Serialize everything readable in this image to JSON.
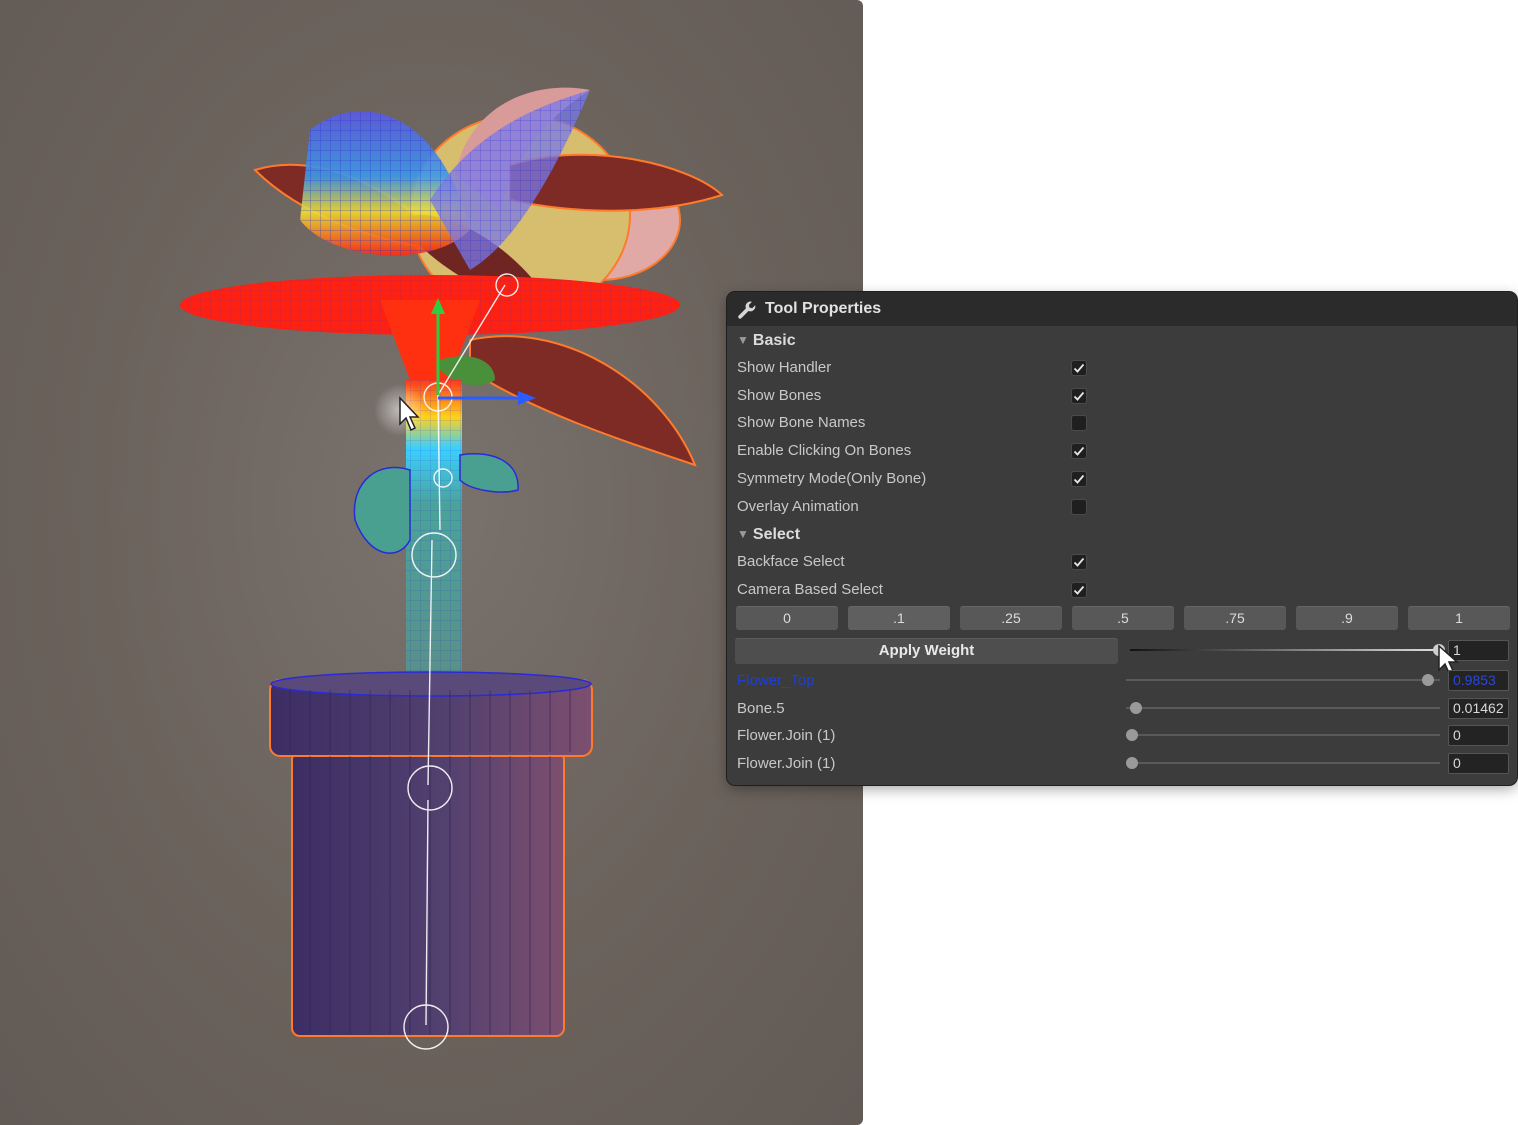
{
  "panel": {
    "title": "Tool Properties",
    "sections": {
      "basic": "Basic",
      "select": "Select"
    },
    "basic_options": [
      {
        "label": "Show Handler",
        "checked": true
      },
      {
        "label": "Show Bones",
        "checked": true
      },
      {
        "label": "Show Bone Names",
        "checked": false
      },
      {
        "label": "Enable Clicking On Bones",
        "checked": true
      },
      {
        "label": "Symmetry Mode(Only Bone)",
        "checked": true
      },
      {
        "label": "Overlay Animation",
        "checked": false
      }
    ],
    "select_options": [
      {
        "label": "Backface Select",
        "checked": true
      },
      {
        "label": "Camera Based Select",
        "checked": true
      }
    ],
    "weight_presets": [
      "0",
      ".1",
      ".25",
      ".5",
      ".75",
      ".9",
      "1"
    ],
    "apply_weight": {
      "label": "Apply Weight",
      "value": "1",
      "slider": 1.0
    },
    "bones": [
      {
        "name": "Flower_Top",
        "value": "0.9853",
        "slider": 0.985,
        "selected": true
      },
      {
        "name": "Bone.5",
        "value": "0.01462",
        "slider": 0.0146,
        "selected": false
      },
      {
        "name": "Flower.Join (1)",
        "value": "0",
        "slider": 0,
        "selected": false
      },
      {
        "name": "Flower.Join (1)",
        "value": "0",
        "slider": 0,
        "selected": false
      }
    ]
  },
  "viewport": {
    "object": "potted flower model with bone rig and weight paint",
    "colors": {
      "background": "#6b625c",
      "pot": "#4d3d6e",
      "selection_outline": "#ff7a2a"
    }
  }
}
